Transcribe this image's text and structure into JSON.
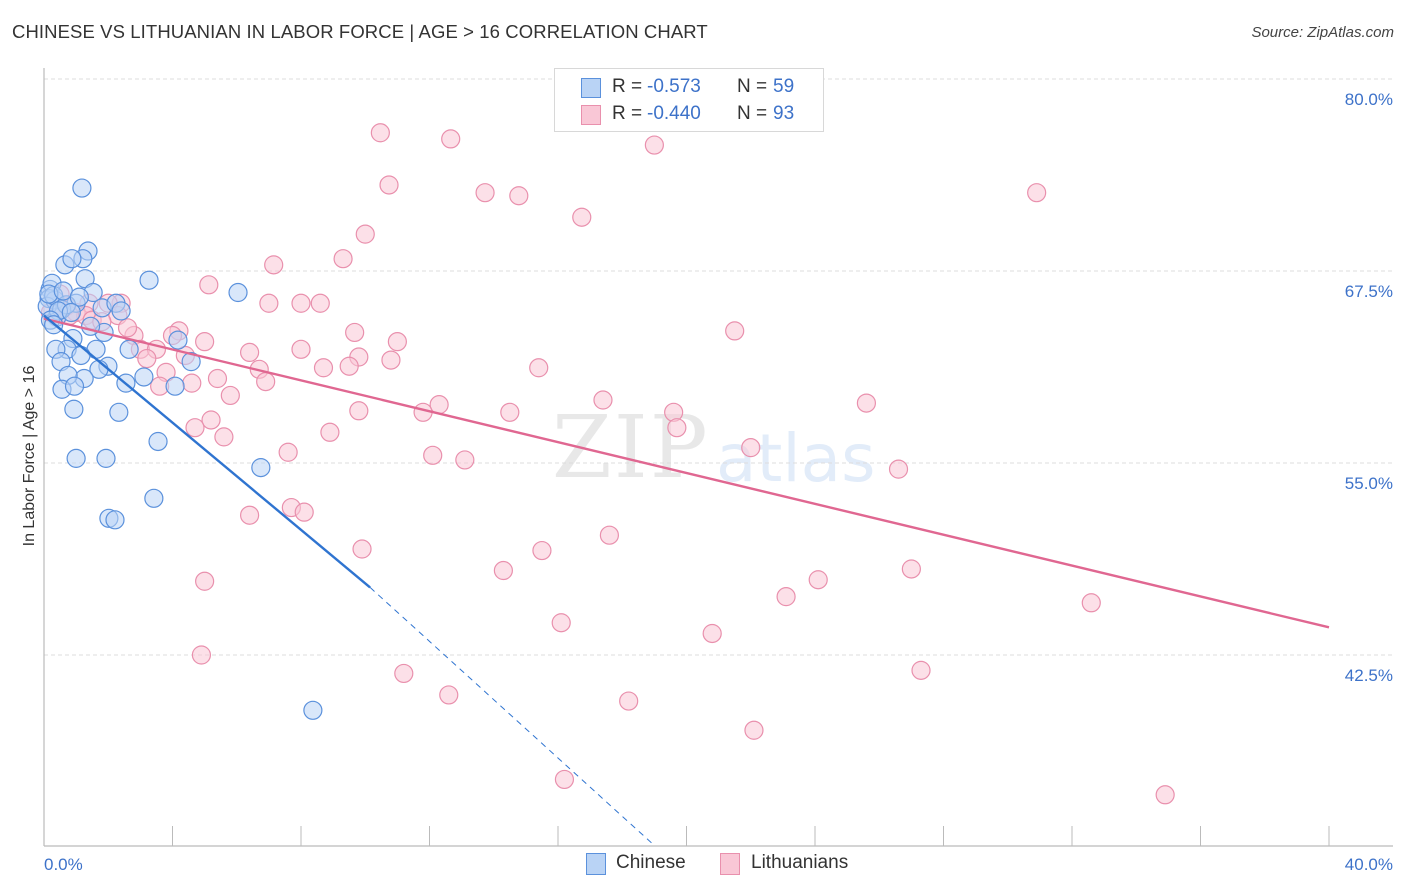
{
  "title": "CHINESE VS LITHUANIAN IN LABOR FORCE | AGE > 16 CORRELATION CHART",
  "source": "Source: ZipAtlas.com",
  "watermark": {
    "zip": "ZIP",
    "atlas": "atlas"
  },
  "legend": {
    "rows": [
      {
        "r_label": "R =",
        "r_value": "-0.573",
        "n_label": "N =",
        "n_value": "59"
      },
      {
        "r_label": "R =",
        "r_value": "-0.440",
        "n_label": "N =",
        "n_value": "93"
      }
    ]
  },
  "bottom_legend": {
    "chinese": "Chinese",
    "lithuanians": "Lithuanians"
  },
  "colors": {
    "chinese_fill": "#b9d3f5",
    "chinese_stroke": "#5b91dc",
    "chinese_line": "#2f74d0",
    "lithuanian_fill": "#f9c7d6",
    "lithuanian_stroke": "#e990ad",
    "lithuanian_line": "#e06791",
    "tick_label": "#3d72c9"
  },
  "chart_data": {
    "type": "scatter",
    "title": "CHINESE VS LITHUANIAN IN LABOR FORCE | AGE > 16 CORRELATION CHART",
    "xlabel": "",
    "ylabel": "In Labor Force | Age > 16",
    "xlim": [
      0,
      40
    ],
    "ylim": [
      32.5,
      80.0
    ],
    "x_tick_labels": [
      {
        "value": 0,
        "label": "0.0%"
      },
      {
        "value": 40,
        "label": "40.0%"
      }
    ],
    "x_minor_ticks": [
      0,
      4,
      8,
      12,
      16,
      20,
      24,
      28,
      32,
      36,
      40
    ],
    "y_ticks": [
      {
        "value": 80.0,
        "label": "80.0%"
      },
      {
        "value": 67.5,
        "label": "67.5%"
      },
      {
        "value": 55.0,
        "label": "55.0%"
      },
      {
        "value": 42.5,
        "label": "42.5%"
      }
    ],
    "grid": true,
    "legend_position": "top-center",
    "series": [
      {
        "name": "Chinese",
        "R": -0.573,
        "N": 59,
        "points": [
          [
            1.18,
            72.9
          ],
          [
            1.37,
            68.8
          ],
          [
            1.21,
            68.3
          ],
          [
            0.65,
            67.9
          ],
          [
            0.87,
            68.3
          ],
          [
            1.28,
            67.0
          ],
          [
            0.19,
            66.3
          ],
          [
            0.25,
            66.7
          ],
          [
            3.27,
            66.9
          ],
          [
            6.04,
            66.1
          ],
          [
            1.53,
            66.1
          ],
          [
            1.0,
            65.4
          ],
          [
            0.16,
            65.7
          ],
          [
            0.34,
            65.6
          ],
          [
            1.81,
            65.1
          ],
          [
            2.24,
            65.4
          ],
          [
            0.4,
            64.5
          ],
          [
            0.1,
            65.2
          ],
          [
            0.3,
            65.9
          ],
          [
            0.55,
            65.0
          ],
          [
            0.7,
            65.3
          ],
          [
            0.45,
            64.9
          ],
          [
            0.2,
            64.3
          ],
          [
            4.17,
            63.0
          ],
          [
            1.87,
            63.5
          ],
          [
            0.9,
            63.1
          ],
          [
            0.72,
            62.4
          ],
          [
            0.37,
            62.4
          ],
          [
            1.62,
            62.4
          ],
          [
            2.65,
            62.4
          ],
          [
            4.58,
            61.6
          ],
          [
            1.99,
            61.3
          ],
          [
            0.53,
            61.6
          ],
          [
            1.71,
            61.1
          ],
          [
            1.25,
            60.5
          ],
          [
            2.55,
            60.2
          ],
          [
            3.11,
            60.6
          ],
          [
            0.75,
            60.7
          ],
          [
            4.08,
            60.0
          ],
          [
            0.56,
            59.8
          ],
          [
            0.93,
            58.5
          ],
          [
            2.33,
            58.3
          ],
          [
            3.55,
            56.4
          ],
          [
            1.0,
            55.3
          ],
          [
            1.93,
            55.3
          ],
          [
            6.75,
            54.7
          ],
          [
            3.42,
            52.7
          ],
          [
            2.02,
            51.4
          ],
          [
            2.21,
            51.3
          ],
          [
            8.37,
            38.9
          ],
          [
            0.15,
            66.0
          ],
          [
            0.6,
            66.2
          ],
          [
            1.1,
            65.8
          ],
          [
            0.85,
            64.8
          ],
          [
            1.45,
            63.9
          ],
          [
            0.3,
            64.0
          ],
          [
            2.4,
            64.9
          ],
          [
            1.15,
            62.0
          ],
          [
            0.95,
            60.0
          ]
        ],
        "trend": {
          "x0": 0,
          "y0": 64.6,
          "x_solid_end": 10.15,
          "y_solid_end": 46.9,
          "x1": 19.0,
          "y1": 30.1
        }
      },
      {
        "name": "Lithuanians",
        "R": -0.44,
        "N": 93,
        "points": [
          [
            10.47,
            76.5
          ],
          [
            12.66,
            76.1
          ],
          [
            19.0,
            75.7
          ],
          [
            10.74,
            73.1
          ],
          [
            13.73,
            72.6
          ],
          [
            14.78,
            72.4
          ],
          [
            30.9,
            72.6
          ],
          [
            16.74,
            71.0
          ],
          [
            10.0,
            69.9
          ],
          [
            9.31,
            68.3
          ],
          [
            7.15,
            67.9
          ],
          [
            5.13,
            66.6
          ],
          [
            7.0,
            65.4
          ],
          [
            8.0,
            65.4
          ],
          [
            8.6,
            65.4
          ],
          [
            2.4,
            65.4
          ],
          [
            2.0,
            65.4
          ],
          [
            1.4,
            65.4
          ],
          [
            0.4,
            65.4
          ],
          [
            0.7,
            65.2
          ],
          [
            1.0,
            64.8
          ],
          [
            1.3,
            64.6
          ],
          [
            0.2,
            64.8
          ],
          [
            2.3,
            64.6
          ],
          [
            1.5,
            64.3
          ],
          [
            0.8,
            64.6
          ],
          [
            21.5,
            63.6
          ],
          [
            9.67,
            63.5
          ],
          [
            4.2,
            63.6
          ],
          [
            4.0,
            63.3
          ],
          [
            2.8,
            63.3
          ],
          [
            5.0,
            62.9
          ],
          [
            11.0,
            62.9
          ],
          [
            8.0,
            62.4
          ],
          [
            3.0,
            62.4
          ],
          [
            3.5,
            62.4
          ],
          [
            6.4,
            62.2
          ],
          [
            4.4,
            62.0
          ],
          [
            9.8,
            61.9
          ],
          [
            10.8,
            61.7
          ],
          [
            9.5,
            61.3
          ],
          [
            8.7,
            61.2
          ],
          [
            15.4,
            61.2
          ],
          [
            6.7,
            61.1
          ],
          [
            3.8,
            60.9
          ],
          [
            5.4,
            60.5
          ],
          [
            6.9,
            60.3
          ],
          [
            3.6,
            60.0
          ],
          [
            5.8,
            59.4
          ],
          [
            17.4,
            59.1
          ],
          [
            25.6,
            58.9
          ],
          [
            12.3,
            58.8
          ],
          [
            9.8,
            58.4
          ],
          [
            11.8,
            58.3
          ],
          [
            14.5,
            58.3
          ],
          [
            19.6,
            58.3
          ],
          [
            5.2,
            57.8
          ],
          [
            4.7,
            57.3
          ],
          [
            19.7,
            57.3
          ],
          [
            8.9,
            57.0
          ],
          [
            5.6,
            56.7
          ],
          [
            22.0,
            56.0
          ],
          [
            7.6,
            55.7
          ],
          [
            12.1,
            55.5
          ],
          [
            13.1,
            55.2
          ],
          [
            26.6,
            54.6
          ],
          [
            7.7,
            52.1
          ],
          [
            8.1,
            51.8
          ],
          [
            6.4,
            51.6
          ],
          [
            17.6,
            50.3
          ],
          [
            9.9,
            49.4
          ],
          [
            15.5,
            49.3
          ],
          [
            14.3,
            48.0
          ],
          [
            27.0,
            48.1
          ],
          [
            24.1,
            47.4
          ],
          [
            5.0,
            47.3
          ],
          [
            23.1,
            46.3
          ],
          [
            32.6,
            45.9
          ],
          [
            16.1,
            44.6
          ],
          [
            20.8,
            43.9
          ],
          [
            4.9,
            42.5
          ],
          [
            11.2,
            41.3
          ],
          [
            27.3,
            41.5
          ],
          [
            12.6,
            39.9
          ],
          [
            18.2,
            39.5
          ],
          [
            22.1,
            37.6
          ],
          [
            16.2,
            34.4
          ],
          [
            34.9,
            33.4
          ],
          [
            0.5,
            66.0
          ],
          [
            1.8,
            64.2
          ],
          [
            3.2,
            61.8
          ],
          [
            2.6,
            63.8
          ],
          [
            4.6,
            60.2
          ]
        ],
        "trend": {
          "x0": 0,
          "y0": 64.4,
          "x1": 40,
          "y1": 44.3
        }
      }
    ]
  }
}
